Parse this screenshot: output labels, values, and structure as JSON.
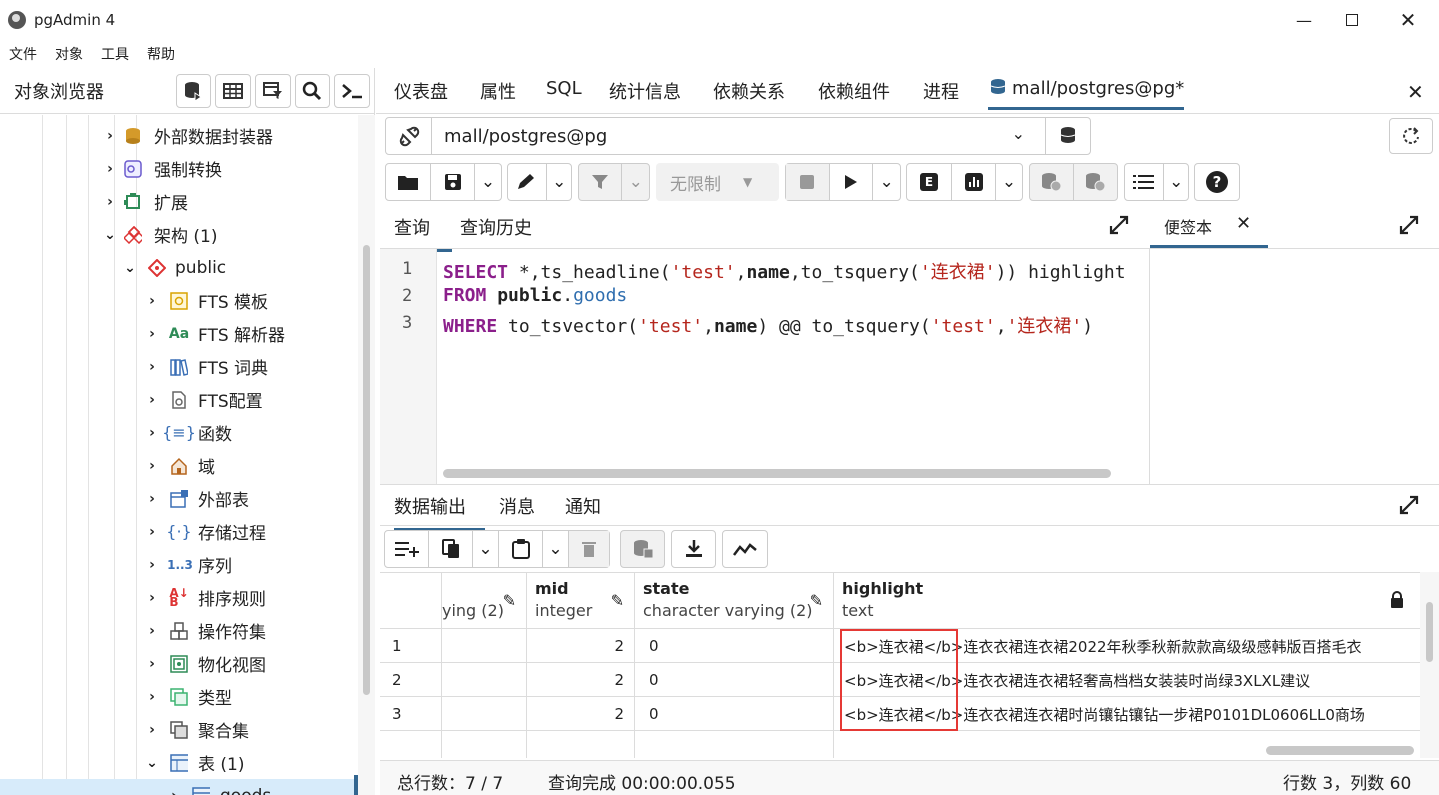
{
  "window": {
    "title": "pgAdmin 4"
  },
  "menu": [
    "文件",
    "对象",
    "工具",
    "帮助"
  ],
  "browser": {
    "title": "对象浏览器"
  },
  "tree": [
    {
      "label": "外部数据封装器",
      "icon": "fdw-icon",
      "expanded": false
    },
    {
      "label": "强制转换",
      "icon": "cast-icon",
      "expanded": false
    },
    {
      "label": "扩展",
      "icon": "extension-icon",
      "expanded": false
    },
    {
      "label": "架构 (1)",
      "icon": "schemas-icon",
      "expanded": true
    },
    {
      "label": "public",
      "icon": "schema-icon",
      "expanded": true
    },
    {
      "label": "FTS 模板",
      "icon": "fts-template-icon",
      "expanded": false
    },
    {
      "label": "FTS 解析器",
      "icon": "fts-parser-icon",
      "expanded": false
    },
    {
      "label": "FTS 词典",
      "icon": "fts-dictionary-icon",
      "expanded": false
    },
    {
      "label": "FTS配置",
      "icon": "fts-config-icon",
      "expanded": false
    },
    {
      "label": "函数",
      "icon": "function-icon",
      "expanded": false
    },
    {
      "label": "域",
      "icon": "domain-icon",
      "expanded": false
    },
    {
      "label": "外部表",
      "icon": "foreign-table-icon",
      "expanded": false
    },
    {
      "label": "存储过程",
      "icon": "procedure-icon",
      "expanded": false
    },
    {
      "label": "序列",
      "icon": "sequence-icon",
      "expanded": false
    },
    {
      "label": "排序规则",
      "icon": "collation-icon",
      "expanded": false
    },
    {
      "label": "操作符集",
      "icon": "operator-icon",
      "expanded": false
    },
    {
      "label": "物化视图",
      "icon": "mview-icon",
      "expanded": false
    },
    {
      "label": "类型",
      "icon": "type-icon",
      "expanded": false
    },
    {
      "label": "聚合集",
      "icon": "aggregate-icon",
      "expanded": false
    },
    {
      "label": "表 (1)",
      "icon": "table-icon",
      "expanded": true
    },
    {
      "label": "goods",
      "icon": "table-icon",
      "expanded": false
    }
  ],
  "tabs": [
    "仪表盘",
    "属性",
    "SQL",
    "统计信息",
    "依赖关系",
    "依赖组件",
    "进程",
    "mall/postgres@pg*"
  ],
  "connection": {
    "value": "mall/postgres@pg"
  },
  "query_toolbar": {
    "limit": "无限制"
  },
  "editor_tabs": [
    "查询",
    "查询历史"
  ],
  "notes_tab": "便签本",
  "sql_lines": [
    "1",
    "2",
    "3"
  ],
  "code": {
    "l1": {
      "k1": "SELECT",
      "p1": " *,ts_headline(",
      "s1": "'test'",
      "p2": ",",
      "b1": "name",
      "p3": ",to_tsquery(",
      "s2": "'连衣裙'",
      "p4": ")) highlight"
    },
    "l2": {
      "k1": "FROM",
      "p1": " ",
      "b1": "public",
      "p2": ".",
      "n1": "goods"
    },
    "l3": {
      "k1": "WHERE",
      "p1": " to_tsvector(",
      "s1": "'test'",
      "p2": ",",
      "b1": "name",
      "p3": ") @@ to_tsquery(",
      "s2": "'test'",
      "p4": ",",
      "s3": "'连衣裙'",
      "p5": ")"
    }
  },
  "output_tabs": [
    "数据输出",
    "消息",
    "通知"
  ],
  "grid": {
    "columns": [
      {
        "name": "",
        "type": "ying (2)"
      },
      {
        "name": "mid",
        "type": "integer"
      },
      {
        "name": "state",
        "type": "character varying (2)"
      },
      {
        "name": "highlight",
        "type": "text"
      }
    ],
    "rows": [
      {
        "n": "1",
        "mid": "2",
        "state": "0",
        "highlight": "<b>连衣裙</b>连衣衣裙连衣裙2022年秋季秋新款款高级级感韩版百搭毛衣"
      },
      {
        "n": "2",
        "mid": "2",
        "state": "0",
        "highlight": "<b>连衣裙</b>连衣衣裙连衣裙轻奢高档档女装装时尚绿3XLXL建议"
      },
      {
        "n": "3",
        "mid": "2",
        "state": "0",
        "highlight": "<b>连衣裙</b>连衣衣裙连衣裙时尚镶钻镶钻一步裙P0101DL0606LL0商场"
      }
    ]
  },
  "status": {
    "total": "总行数：7 / 7",
    "query": "查询完成 00:00:00.055",
    "pos": "行数 3，列数 60"
  }
}
